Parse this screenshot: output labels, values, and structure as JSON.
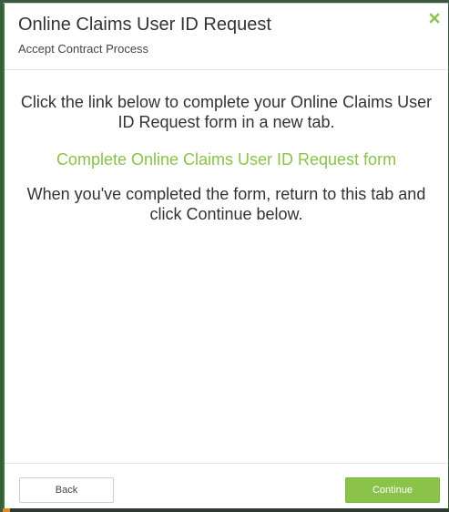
{
  "modal": {
    "title": "Online Claims User ID Request",
    "subtitle": "Accept Contract Process",
    "close_icon": "close-icon",
    "instruction_line1": "Click the link below to complete your Online Claims User ID Request form in a new tab.",
    "link_text": "Complete Online Claims User ID Request form",
    "instruction_line2": "When you've completed the form, return to this tab and click Continue below."
  },
  "footer": {
    "back_label": "Back",
    "continue_label": "Continue"
  },
  "colors": {
    "accent_green": "#8bc34a",
    "border_green": "#2e7d32",
    "text_dark": "#333333"
  }
}
